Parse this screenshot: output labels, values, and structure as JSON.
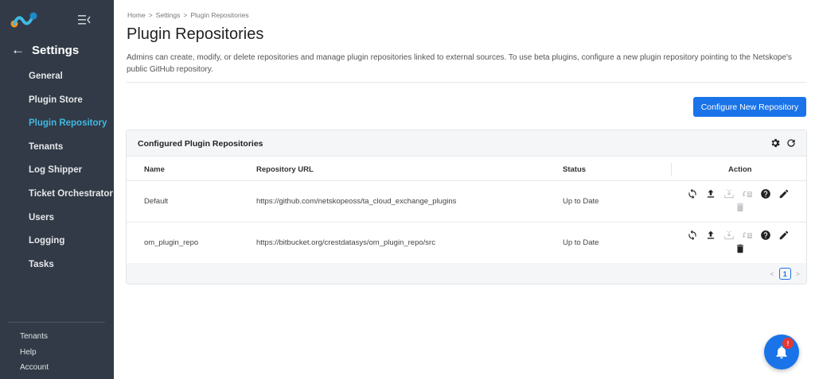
{
  "sidebar": {
    "back_label": "Settings",
    "items": [
      {
        "label": "General"
      },
      {
        "label": "Plugin Store"
      },
      {
        "label": "Plugin Repository",
        "active": true
      },
      {
        "label": "Tenants"
      },
      {
        "label": "Log Shipper"
      },
      {
        "label": "Ticket Orchestrator"
      },
      {
        "label": "Users"
      },
      {
        "label": "Logging"
      },
      {
        "label": "Tasks"
      }
    ],
    "footer": [
      "Tenants",
      "Help",
      "Account"
    ]
  },
  "breadcrumb": [
    "Home",
    "Settings",
    "Plugin Repositories"
  ],
  "breadcrumb_sep": ">",
  "page_title": "Plugin Repositories",
  "description": "Admins can create, modify, or delete repositories and manage plugin repositories linked to external sources. To use beta plugins, configure a new plugin repository pointing to the Netskope's public GitHub repository.",
  "configure_button": "Configure New Repository",
  "card": {
    "title": "Configured Plugin Repositories",
    "columns": {
      "name": "Name",
      "url": "Repository URL",
      "status": "Status",
      "action": "Action"
    },
    "rows": [
      {
        "name": "Default",
        "url": "https://github.com/netskopeoss/ta_cloud_exchange_plugins",
        "status": "Up to Date"
      },
      {
        "name": "om_plugin_repo",
        "url": "https://bitbucket.org/crestdatasys/om_plugin_repo/src",
        "status": "Up to Date"
      }
    ],
    "pagination": {
      "current_page": "1",
      "prev": "<",
      "next": ">"
    }
  },
  "notification_badge": "!",
  "colors": {
    "sidebar_bg": "#313a46",
    "accent": "#1a73e8",
    "active_nav": "#3fb9e3"
  },
  "icons": [
    "logo-icon",
    "collapse-menu-icon",
    "back-arrow-icon",
    "gear-icon",
    "refresh-icon",
    "sync-icon",
    "upload-icon",
    "download-icon",
    "merge-icon",
    "help-icon",
    "edit-icon",
    "trash-icon",
    "bell-icon"
  ]
}
